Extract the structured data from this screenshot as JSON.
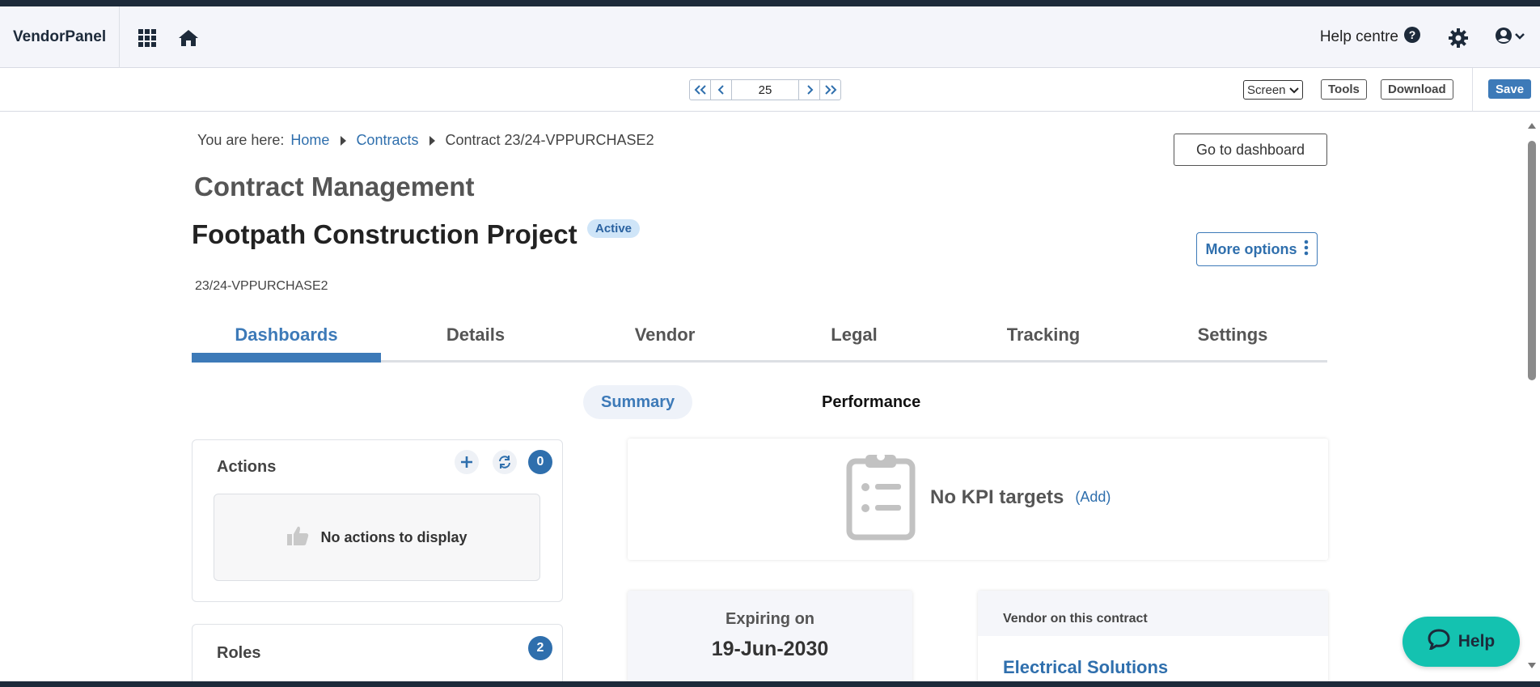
{
  "header": {
    "brand": "VendorPanel",
    "help_centre_label": "Help centre",
    "icons": [
      "apps-grid-icon",
      "home-icon",
      "question-circle-icon",
      "gear-icon",
      "user-circle-icon",
      "chevron-down-icon"
    ]
  },
  "toolbar": {
    "page_value": "25",
    "view_select": "Screen",
    "tools_label": "Tools",
    "download_label": "Download",
    "save_label": "Save"
  },
  "breadcrumb": {
    "prefix": "You are here:",
    "items": [
      "Home",
      "Contracts",
      "Contract 23/24-VPPURCHASE2"
    ]
  },
  "goto_dashboard_label": "Go to dashboard",
  "page_heading": "Contract Management",
  "contract": {
    "title": "Footpath Construction Project",
    "status": "Active",
    "code": "23/24-VPPURCHASE2"
  },
  "more_options_label": "More options",
  "tabs": [
    "Dashboards",
    "Details",
    "Vendor",
    "Legal",
    "Tracking",
    "Settings"
  ],
  "active_tab": "Dashboards",
  "subtabs": [
    "Summary",
    "Performance"
  ],
  "active_subtab": "Summary",
  "actions": {
    "title": "Actions",
    "count": "0",
    "empty_text": "No actions to display"
  },
  "roles": {
    "title": "Roles",
    "count": "2"
  },
  "kpi": {
    "text": "No KPI targets",
    "add_label": "(Add)"
  },
  "expiry": {
    "label": "Expiring on",
    "date": "19-Jun-2030"
  },
  "vendor": {
    "label": "Vendor on this contract",
    "name": "Electrical Solutions"
  },
  "help_fab_label": "Help",
  "colors": {
    "accent": "#3d7ab8",
    "badge_bg": "#cfe5f8",
    "help_fab": "#14c2b0",
    "topbar_bg": "#f4f5fa"
  }
}
